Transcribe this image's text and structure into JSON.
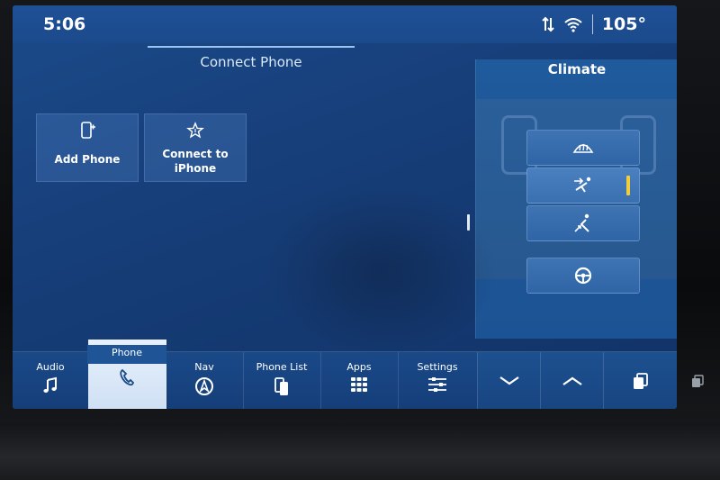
{
  "status_bar": {
    "time": "5:06",
    "temperature": "105°"
  },
  "phone_panel": {
    "title": "Connect Phone",
    "tiles": [
      {
        "label": "Add Phone",
        "icon": "add-phone-icon"
      },
      {
        "label_line1": "Connect to",
        "label_line2": "iPhone",
        "icon": "carplay-star-icon"
      }
    ]
  },
  "climate_panel": {
    "title": "Climate",
    "modes": [
      {
        "icon": "defrost-icon",
        "selected": false
      },
      {
        "icon": "panel-vent-icon",
        "selected": true
      },
      {
        "icon": "floor-vent-icon",
        "selected": false
      },
      {
        "icon": "heated-steering-wheel-icon",
        "selected": false
      }
    ],
    "indicator_color": "#f3cc3a"
  },
  "bottom_nav": {
    "items": [
      {
        "label": "Audio",
        "icon": "music-note-icon"
      },
      {
        "label": "Phone",
        "icon": "phone-handset-icon",
        "active": true
      },
      {
        "label": "Nav",
        "icon": "navigation-arrow-icon"
      },
      {
        "label": "Phone List",
        "icon": "phone-list-icon"
      },
      {
        "label": "Apps",
        "icon": "apps-grid-icon"
      },
      {
        "label": "Settings",
        "icon": "sliders-icon"
      }
    ],
    "controls": [
      {
        "icon": "chevron-down-icon"
      },
      {
        "icon": "chevron-up-icon"
      },
      {
        "icon": "layers-icon"
      }
    ]
  },
  "colors": {
    "screen_blue": "#1b4a8a",
    "accent_light": "#e8f1fb"
  }
}
